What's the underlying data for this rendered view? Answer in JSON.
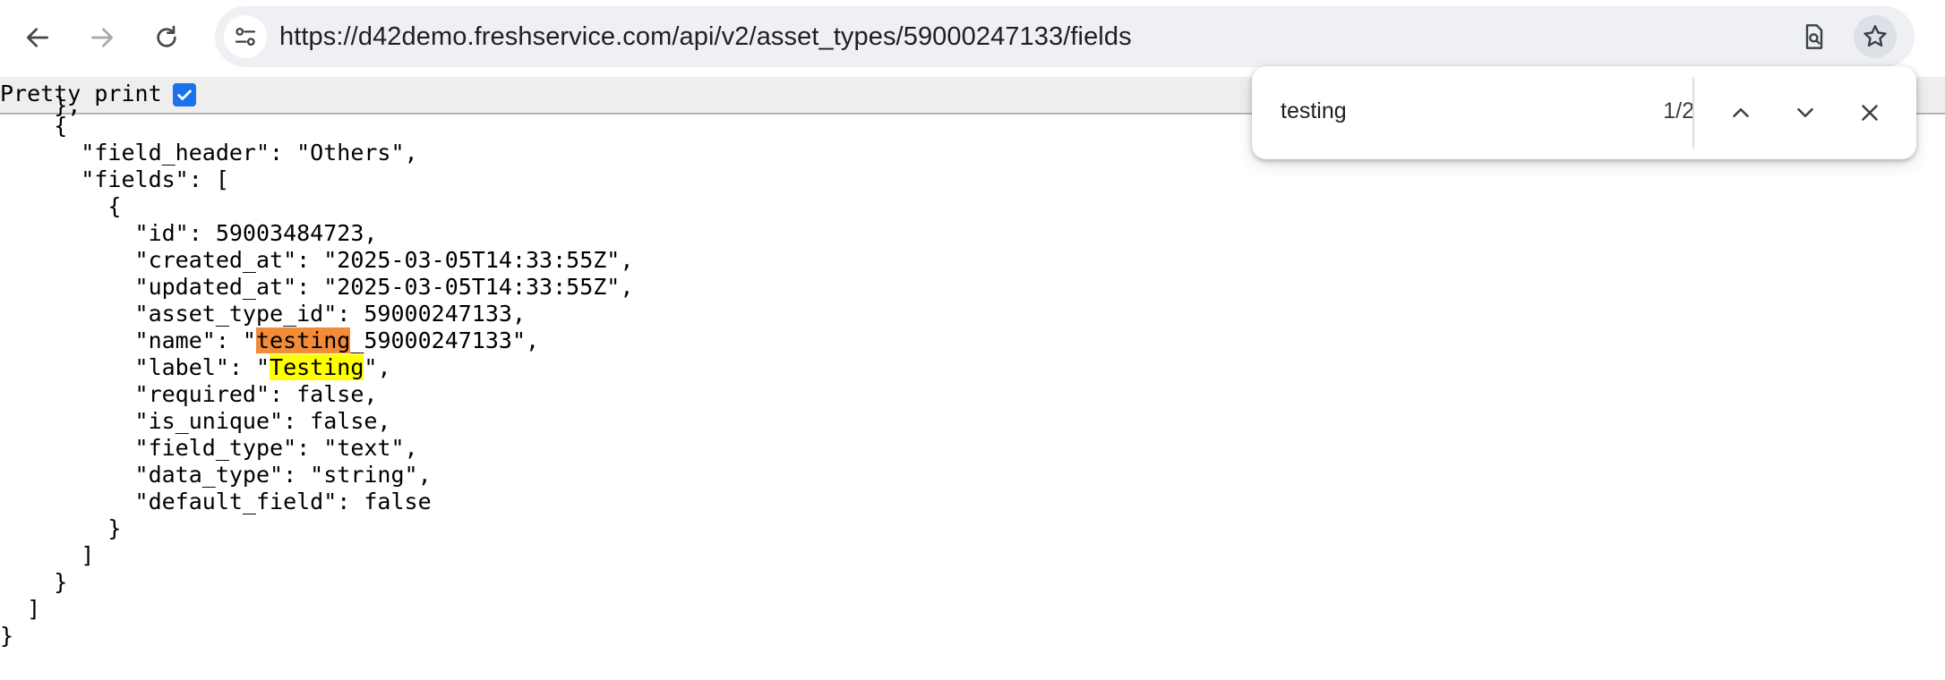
{
  "browser": {
    "url": "https://d42demo.freshservice.com/api/v2/asset_types/59000247133/fields",
    "icons": {
      "back": "back-arrow-icon",
      "forward": "forward-arrow-icon",
      "reload": "reload-icon",
      "site_info": "site-settings-icon",
      "page_search": "page-search-icon",
      "bookmark": "bookmark-star-icon"
    }
  },
  "viewer": {
    "pretty_print_label": "Pretty print",
    "pretty_print_checked": true
  },
  "json_lines": {
    "l0": "    },",
    "l1": "    {",
    "l2": "      \"field_header\": \"Others\",",
    "l3": "      \"fields\": [",
    "l4": "        {",
    "l5": "          \"id\": 59003484723,",
    "l6": "          \"created_at\": \"2025-03-05T14:33:55Z\",",
    "l7": "          \"updated_at\": \"2025-03-05T14:33:55Z\",",
    "l8": "          \"asset_type_id\": 59000247133,",
    "l9_prefix": "          \"name\": \"",
    "l9_match": "testing",
    "l9_suffix": "_59000247133\",",
    "l10_prefix": "          \"label\": \"",
    "l10_match": "Testing",
    "l10_suffix": "\",",
    "l11": "          \"required\": false,",
    "l12": "          \"is_unique\": false,",
    "l13": "          \"field_type\": \"text\",",
    "l14": "          \"data_type\": \"string\",",
    "l15": "          \"default_field\": false",
    "l16": "        }",
    "l17": "      ]",
    "l18": "    }",
    "l19": "  ]",
    "l20": "}"
  },
  "find_bar": {
    "query": "testing",
    "count": "1/2",
    "icons": {
      "previous": "chevron-up-icon",
      "next": "chevron-down-icon",
      "close": "close-icon"
    }
  },
  "colors": {
    "active_match": "#f28c38",
    "other_match": "#ffff00",
    "checkbox": "#1a73e8",
    "omnibox": "#eef0f4"
  }
}
